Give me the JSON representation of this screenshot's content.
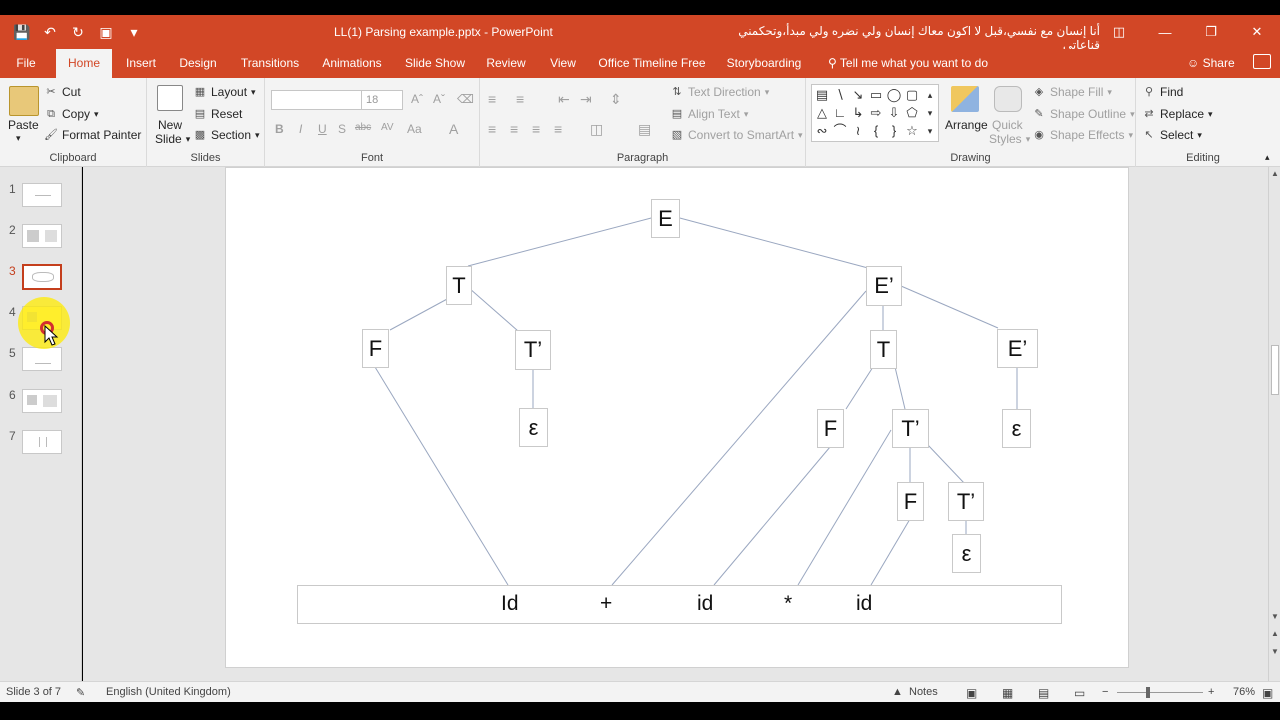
{
  "window": {
    "title": "LL(1) Parsing example.pptx  -  PowerPoint",
    "overlay_text": "أنا إنسان مع نفسي،قبل لا اكون معاك إنسان ولي نضره ولي مبدأ،وتحكمني قناعاتي"
  },
  "tabs": [
    "File",
    "Home",
    "Insert",
    "Design",
    "Transitions",
    "Animations",
    "Slide Show",
    "Review",
    "View",
    "Office Timeline Free",
    "Storyboarding"
  ],
  "active_tab": "Home",
  "tell_me": "Tell me what you want to do",
  "share": "Share",
  "ribbon": {
    "clipboard": {
      "paste": "Paste",
      "cut": "Cut",
      "copy": "Copy",
      "format_painter": "Format Painter",
      "label": "Clipboard"
    },
    "slides": {
      "new_slide": "New",
      "new_slide2": "Slide",
      "layout": "Layout",
      "reset": "Reset",
      "section": "Section",
      "label": "Slides"
    },
    "font": {
      "size": "18",
      "label": "Font",
      "bold": "B",
      "italic": "I",
      "underline": "U",
      "strike": "S",
      "abc": "abc",
      "av": "AV",
      "aa": "Aa",
      "a": "A"
    },
    "paragraph": {
      "text_direction": "Text Direction",
      "align_text": "Align Text",
      "convert_smartart": "Convert to SmartArt",
      "label": "Paragraph"
    },
    "drawing": {
      "arrange": "Arrange",
      "quick_styles": "Quick",
      "quick_styles2": "Styles",
      "shape_fill": "Shape Fill",
      "shape_outline": "Shape Outline",
      "shape_effects": "Shape Effects",
      "label": "Drawing"
    },
    "editing": {
      "find": "Find",
      "replace": "Replace",
      "select": "Select",
      "label": "Editing"
    }
  },
  "thumbnails": [
    "1",
    "2",
    "3",
    "4",
    "5",
    "6",
    "7"
  ],
  "active_slide": 3,
  "slide": {
    "nodes": [
      "E",
      "T",
      "E’",
      "F",
      "T’",
      "T",
      "E’",
      "ε",
      "F",
      "T’",
      "ε",
      "F",
      "T’",
      "ε"
    ],
    "tokens": [
      "Id",
      "+",
      "id",
      "*",
      "id"
    ]
  },
  "status": {
    "slide_info": "Slide 3 of 7",
    "language": "English (United Kingdom)",
    "notes": "Notes",
    "zoom": "76%"
  },
  "colors": {
    "accent": "#d24726",
    "active_thumb": "#c43e1c"
  }
}
